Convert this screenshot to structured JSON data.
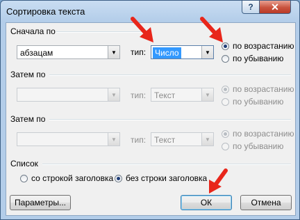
{
  "window": {
    "title": "Сортировка текста"
  },
  "titlebar": {
    "help": "?",
    "close": "✕"
  },
  "sort1": {
    "heading": "Сначала по",
    "field": "абзацам",
    "type_label": "тип:",
    "type_value": "Число",
    "asc": "по возрастанию",
    "desc": "по убыванию"
  },
  "sort2": {
    "heading": "Затем по",
    "field": "",
    "type_label": "тип:",
    "type_value": "Текст",
    "asc": "по возрастанию",
    "desc": "по убыванию"
  },
  "sort3": {
    "heading": "Затем по",
    "field": "",
    "type_label": "тип:",
    "type_value": "Текст",
    "asc": "по возрастанию",
    "desc": "по убыванию"
  },
  "list": {
    "heading": "Список",
    "with_header": "со строкой заголовка",
    "without_header": "без строки заголовка"
  },
  "buttons": {
    "options": "Параметры...",
    "ok": "ОК",
    "cancel": "Отмена"
  },
  "colors": {
    "annotation_arrow": "#e8261b",
    "selection": "#3399ff"
  }
}
